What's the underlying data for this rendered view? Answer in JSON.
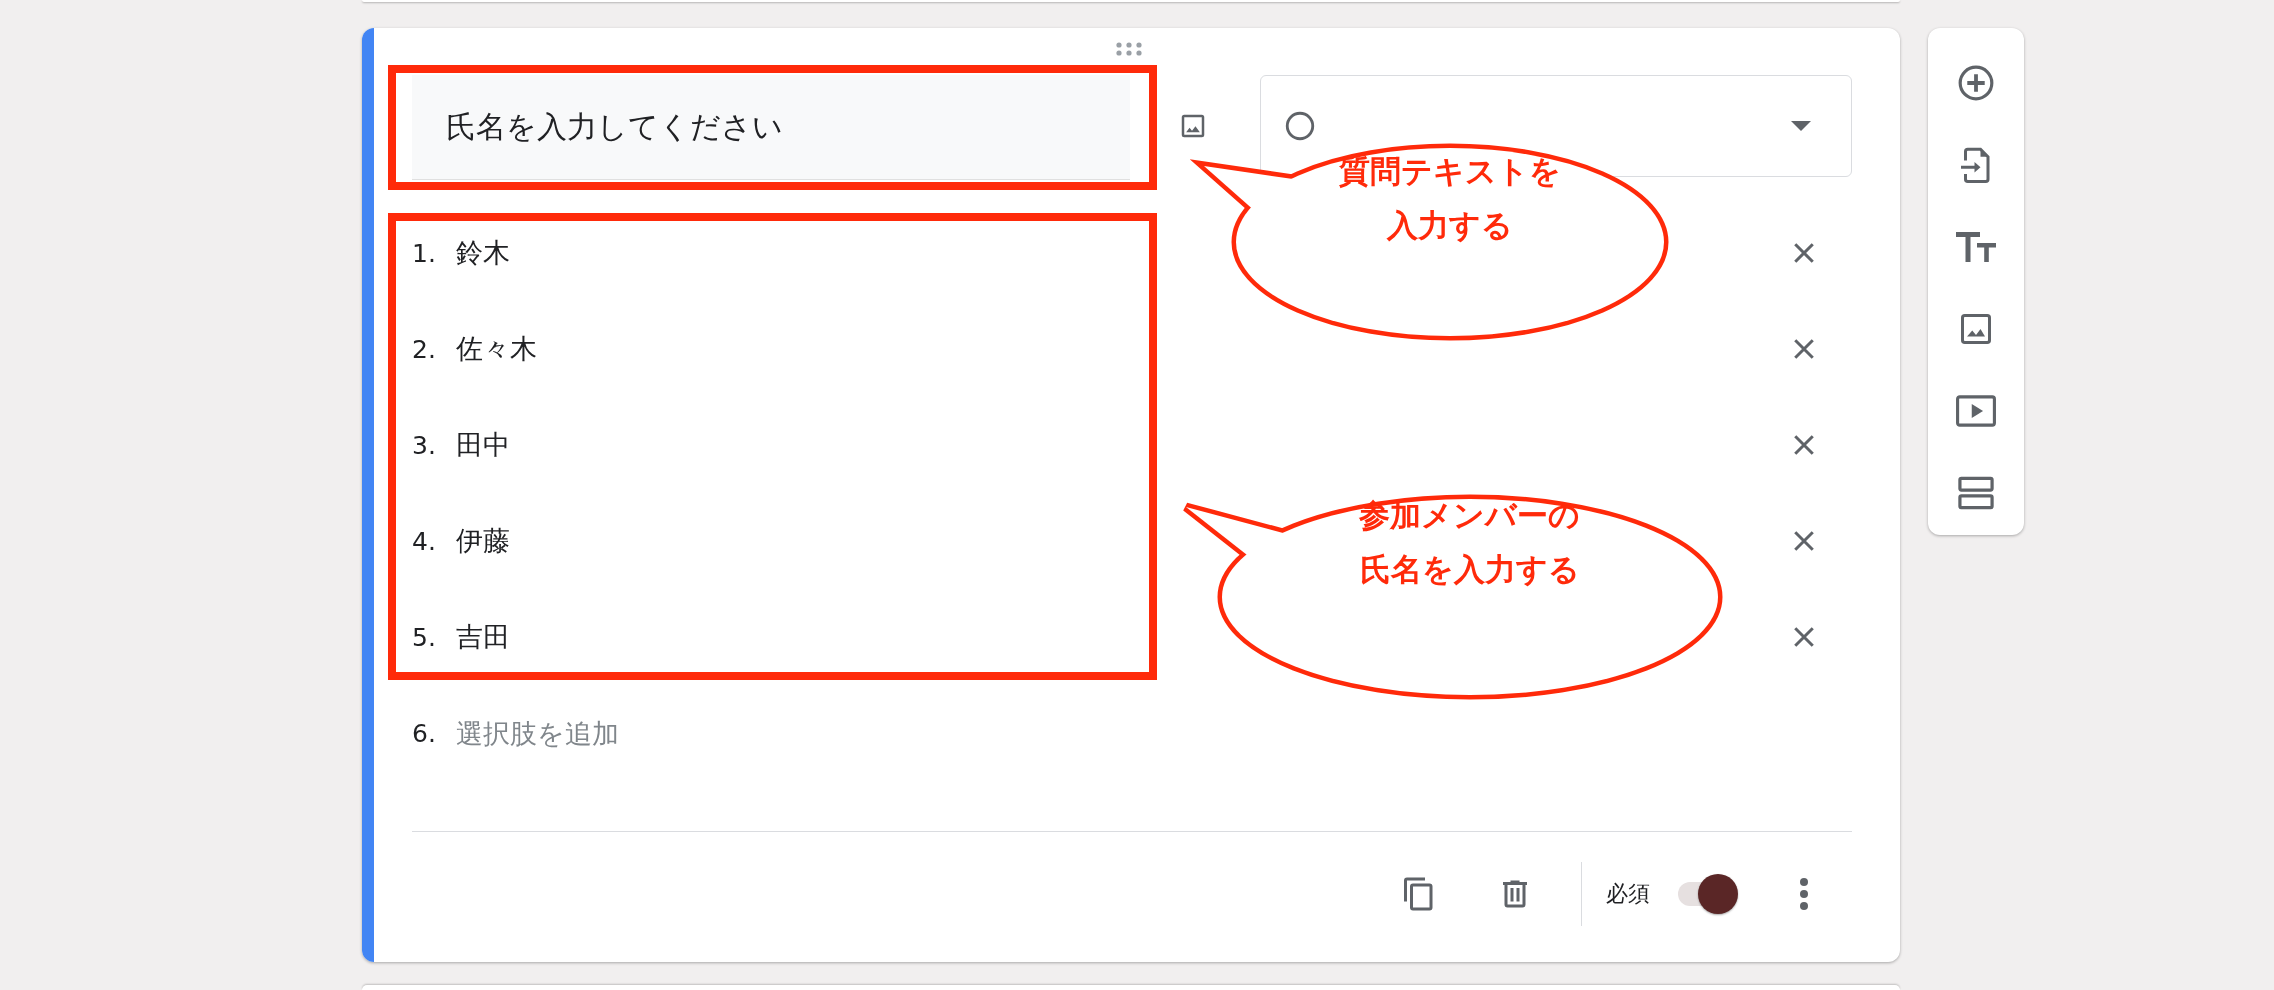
{
  "question": {
    "value": "氏名を入力してください"
  },
  "options": [
    {
      "number": "1.",
      "value": "鈴木"
    },
    {
      "number": "2.",
      "value": "佐々木"
    },
    {
      "number": "3.",
      "value": "田中"
    },
    {
      "number": "4.",
      "value": "伊藤"
    },
    {
      "number": "5.",
      "value": "吉田"
    }
  ],
  "add_option": {
    "number": "6.",
    "placeholder": "選択肢を追加"
  },
  "footer": {
    "required_label": "必須",
    "required": true
  },
  "callouts": [
    {
      "text": "質問テキストを入力する"
    },
    {
      "text": "参加メンバーの氏名を入力する"
    }
  ]
}
